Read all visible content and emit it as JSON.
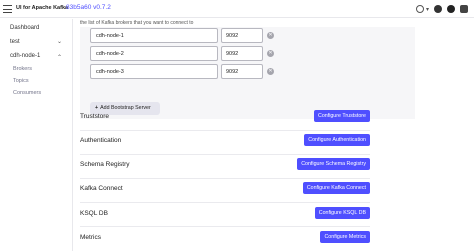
{
  "header": {
    "brand": "UI for Apache Kafka",
    "version": "83b5a60 v0.7.2",
    "theme_caret": "▾"
  },
  "sidebar": {
    "dashboard": "Dashboard",
    "clusters": [
      {
        "name": "test",
        "caret": "⌄"
      },
      {
        "name": "cdh-node-1",
        "caret": "⌃",
        "children": [
          "Brokers",
          "Topics",
          "Consumers"
        ]
      }
    ]
  },
  "bootstrap": {
    "hint": "the list of Kafka brokers that you want to connect to",
    "servers": [
      {
        "host": "cdh-node-1",
        "port": "9092"
      },
      {
        "host": "cdh-node-2",
        "port": "9092"
      },
      {
        "host": "cdh-node-3",
        "port": "9092"
      }
    ],
    "remove_glyph": "✕",
    "add_plus": "+",
    "add_label": "Add Bootstrap Server"
  },
  "sections": [
    {
      "label": "Truststore",
      "button": "Configure Truststore"
    },
    {
      "label": "Authentication",
      "button": "Configure Authentication"
    },
    {
      "label": "Schema Registry",
      "button": "Configure Schema Registry"
    },
    {
      "label": "Kafka Connect",
      "button": "Configure Kafka Connect"
    },
    {
      "label": "KSQL DB",
      "button": "Configure KSQL DB"
    },
    {
      "label": "Metrics",
      "button": "Configure Metrics"
    }
  ],
  "colors": {
    "accent": "#4f4fff"
  }
}
